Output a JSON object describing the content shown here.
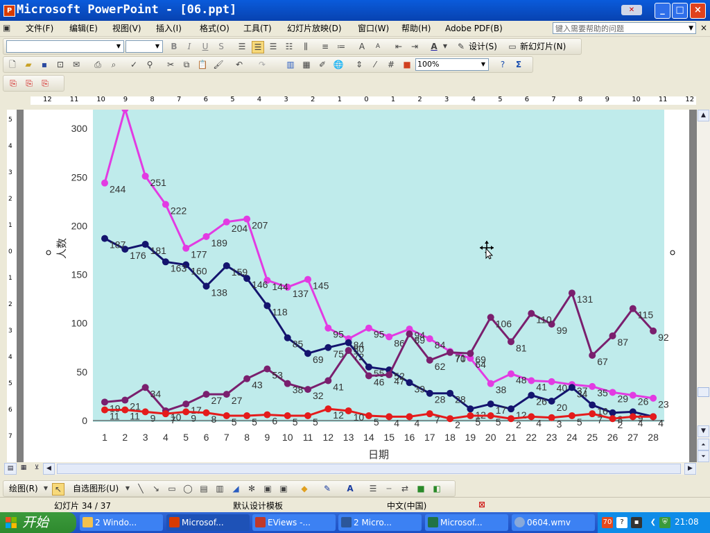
{
  "window": {
    "title": "Microsoft PowerPoint - [06.ppt]",
    "app_icon": "P",
    "minimize_glyph": "_",
    "maximize_glyph": "□",
    "close_glyph": "×"
  },
  "menu": {
    "items": [
      "文件(F)",
      "编辑(E)",
      "视图(V)",
      "插入(I)",
      "格式(O)",
      "工具(T)",
      "幻灯片放映(D)",
      "窗口(W)",
      "帮助(H)",
      "Adobe PDF(B)"
    ],
    "help_placeholder": "键入需要帮助的问题",
    "close_glyph": "×"
  },
  "formatting_toolbar": {
    "font_name": "",
    "font_size": "",
    "bold": "B",
    "italic": "I",
    "underline": "U",
    "shadow": "S",
    "design_label": "设计(S)",
    "new_slide_label": "新幻灯片(N)"
  },
  "standard_toolbar": {
    "zoom": "100%"
  },
  "ruler": {
    "h_ticks": [
      "12",
      "11",
      "10",
      "9",
      "8",
      "7",
      "6",
      "5",
      "4",
      "3",
      "2",
      "1",
      "0",
      "1",
      "2",
      "3",
      "4",
      "5",
      "6",
      "7",
      "8",
      "9",
      "10",
      "11",
      "12"
    ],
    "v_ticks": [
      "5",
      "4",
      "3",
      "2",
      "1",
      "0",
      "1",
      "2",
      "3",
      "4",
      "5",
      "6",
      "7"
    ]
  },
  "chart_data": {
    "type": "line",
    "title": "",
    "xlabel": "日期",
    "ylabel": "人数",
    "x": [
      1,
      2,
      3,
      4,
      5,
      6,
      7,
      8,
      9,
      10,
      11,
      12,
      13,
      14,
      15,
      16,
      17,
      18,
      19,
      20,
      21,
      22,
      23,
      24,
      25,
      26,
      27,
      28
    ],
    "ylim": [
      0,
      300
    ],
    "yticks": [
      0,
      50,
      100,
      150,
      200,
      250,
      300
    ],
    "grid": false,
    "series": [
      {
        "color": "#E23BE2",
        "values": [
          244,
          320,
          251,
          222,
          177,
          189,
          204,
          207,
          144,
          137,
          145,
          95,
          84,
          95,
          86,
          94,
          84,
          71,
          64,
          38,
          48,
          41,
          40,
          37,
          35,
          29,
          26,
          23
        ],
        "labels": [
          244,
          null,
          251,
          222,
          177,
          189,
          204,
          207,
          144,
          137,
          145,
          95,
          84,
          95,
          86,
          94,
          84,
          71,
          64,
          38,
          48,
          41,
          40,
          37,
          35,
          29,
          26,
          23
        ]
      },
      {
        "color": "#14146E",
        "values": [
          187,
          176,
          181,
          163,
          160,
          138,
          159,
          146,
          118,
          85,
          69,
          75,
          80,
          55,
          52,
          39,
          28,
          28,
          12,
          17,
          12,
          26,
          20,
          34,
          16,
          8,
          9,
          4
        ],
        "labels": [
          187,
          176,
          181,
          163,
          160,
          138,
          159,
          146,
          118,
          85,
          69,
          75,
          80,
          55,
          52,
          39,
          28,
          28,
          12,
          17,
          12,
          26,
          20,
          34,
          16,
          8,
          9,
          4
        ]
      },
      {
        "color": "#7A1F6E",
        "values": [
          19,
          21,
          34,
          10,
          17,
          27,
          27,
          43,
          53,
          38,
          32,
          41,
          72,
          46,
          47,
          89,
          62,
          70,
          69,
          106,
          81,
          110,
          99,
          131,
          67,
          87,
          115,
          92
        ],
        "labels": [
          19,
          21,
          34,
          10,
          17,
          27,
          27,
          43,
          53,
          38,
          32,
          41,
          72,
          46,
          47,
          89,
          62,
          70,
          69,
          106,
          81,
          110,
          99,
          131,
          67,
          87,
          115,
          92
        ]
      },
      {
        "color": "#E41B1B",
        "values": [
          11,
          11,
          9,
          7,
          9,
          8,
          5,
          5,
          6,
          5,
          5,
          12,
          10,
          5,
          4,
          4,
          7,
          2,
          5,
          5,
          2,
          4,
          3,
          5,
          7,
          2,
          4,
          4
        ],
        "labels": [
          11,
          11,
          9,
          7,
          9,
          8,
          5,
          5,
          6,
          5,
          5,
          12,
          10,
          5,
          4,
          4,
          7,
          2,
          5,
          5,
          2,
          4,
          3,
          5,
          7,
          2,
          4,
          4
        ]
      }
    ]
  },
  "drawing_toolbar": {
    "draw_label": "绘图(R)",
    "autoshapes_label": "自选图形(U)"
  },
  "status": {
    "slide": "幻灯片 34 / 37",
    "template": "默认设计模板",
    "language": "中文(中国)"
  },
  "taskbar": {
    "start_label": "开始",
    "tasks": [
      "2 Windo...",
      "Microsof...",
      "EViews -...",
      "2 Micro...",
      "Microsof...",
      "0604.wmv"
    ],
    "time": "21:08"
  }
}
